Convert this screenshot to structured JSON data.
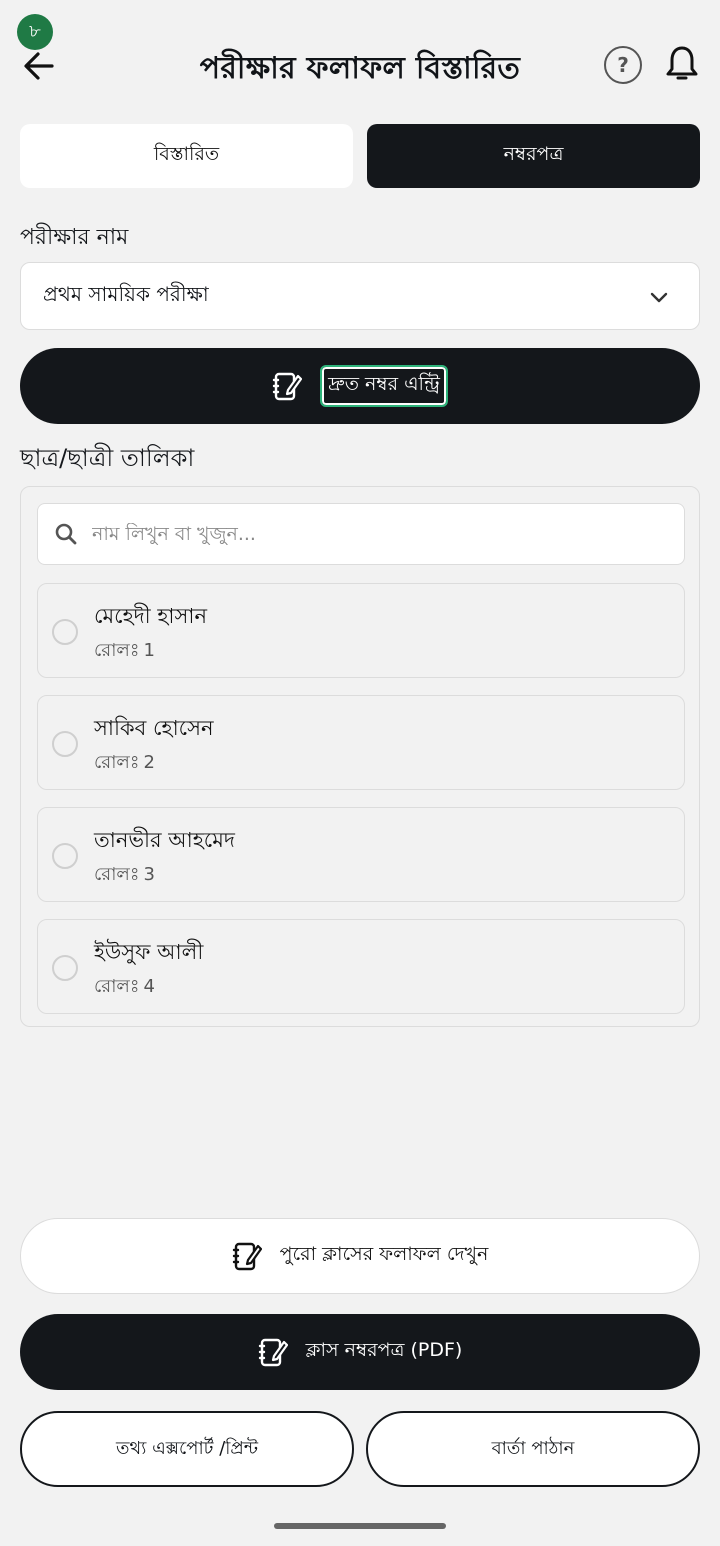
{
  "status": {
    "badge": "৮"
  },
  "header": {
    "title": "পরীক্ষার ফলাফল বিস্তারিত",
    "help_glyph": "?"
  },
  "tabs": [
    {
      "label": "বিস্তারিত",
      "active": false
    },
    {
      "label": "নম্বরপত্র",
      "active": true
    }
  ],
  "exam": {
    "label": "পরীক্ষার নাম",
    "selected": "প্রথম সাময়িক পরীক্ষা"
  },
  "quick_entry": {
    "label": "দ্রুত নম্বর এন্ট্রি"
  },
  "students_section": {
    "label": "ছাত্র/ছাত্রী তালিকা",
    "search_placeholder": "নাম লিখুন বা খুজুন...",
    "roll_prefix": "রোলঃ",
    "students": [
      {
        "name": "মেহেদী হাসান",
        "roll": "1"
      },
      {
        "name": "সাকিব হোসেন",
        "roll": "2"
      },
      {
        "name": "তানভীর আহমেদ",
        "roll": "3"
      },
      {
        "name": "ইউসুফ আলী",
        "roll": "4"
      }
    ]
  },
  "actions": {
    "full_class_results": "পুরো ক্লাসের ফলাফল দেখুন",
    "class_marksheet_pdf": "ক্লাস নম্বরপত্র (PDF)",
    "export_print": "তথ্য এক্সপোর্ট /প্রিন্ট",
    "send_message": "বার্তা পাঠান"
  },
  "icons": {
    "back": "arrow-left-icon",
    "help": "question-circle-icon",
    "bell": "bell-icon",
    "chevron": "chevron-down-icon",
    "note": "notebook-edit-icon",
    "search": "search-icon"
  },
  "colors": {
    "dark": "#14171b",
    "badge": "#1f7a45",
    "focus": "#2db37a",
    "bg": "#f2f2f2"
  }
}
